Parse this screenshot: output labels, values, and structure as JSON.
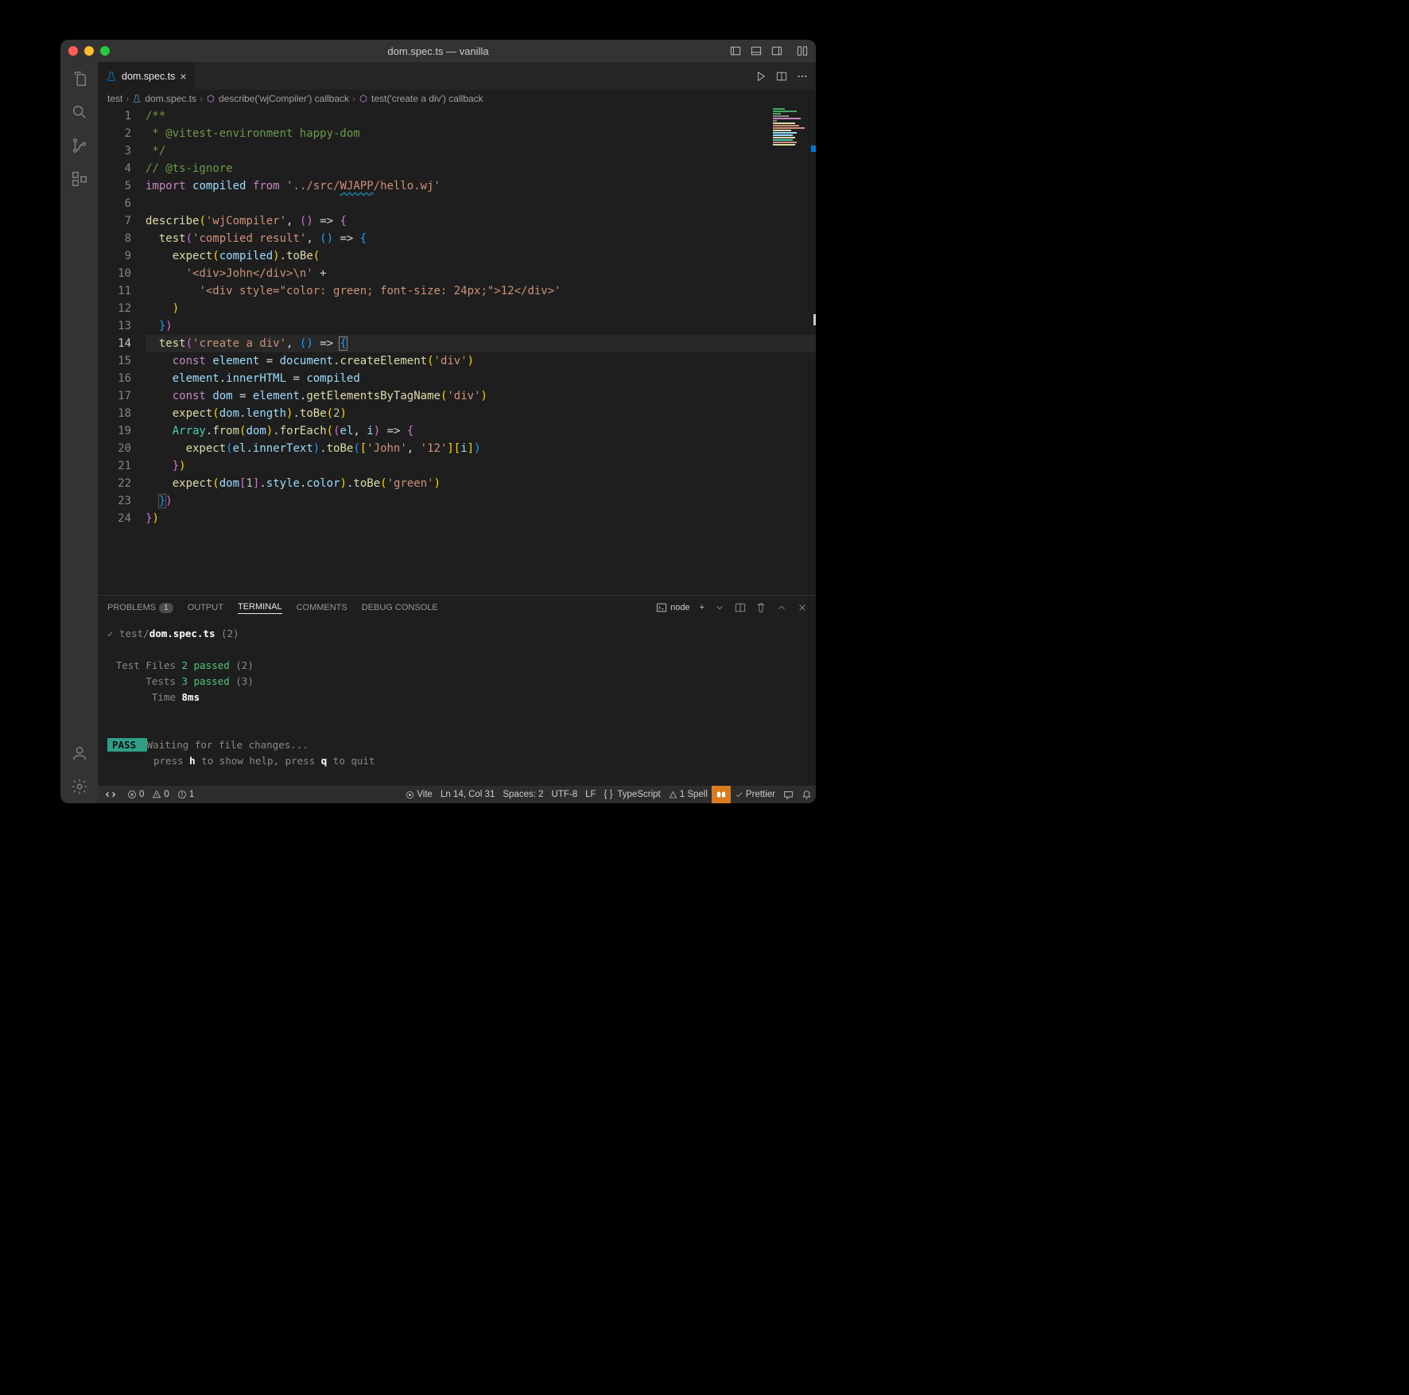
{
  "window": {
    "title": "dom.spec.ts — vanilla"
  },
  "tab": {
    "filename": "dom.spec.ts"
  },
  "breadcrumb": {
    "seg0": "test",
    "seg1": "dom.spec.ts",
    "seg2": "describe('wjCompiler') callback",
    "seg3": "test('create a div') callback"
  },
  "code": {
    "lines": [
      {
        "n": 1
      },
      {
        "n": 2
      },
      {
        "n": 3
      },
      {
        "n": 4
      },
      {
        "n": 5
      },
      {
        "n": 6
      },
      {
        "n": 7
      },
      {
        "n": 8
      },
      {
        "n": 9
      },
      {
        "n": 10
      },
      {
        "n": 11
      },
      {
        "n": 12
      },
      {
        "n": 13
      },
      {
        "n": 14,
        "cur": true
      },
      {
        "n": 15
      },
      {
        "n": 16
      },
      {
        "n": 17
      },
      {
        "n": 18
      },
      {
        "n": 19
      },
      {
        "n": 20
      },
      {
        "n": 21
      },
      {
        "n": 22
      },
      {
        "n": 23
      },
      {
        "n": 24
      }
    ],
    "l1": "/**",
    "l2": " * @vitest-environment happy-dom",
    "l3": " */",
    "l4": "// @ts-ignore",
    "l5_import": "import",
    "l5_compiled": "compiled",
    "l5_from": "from",
    "l5_path1": "'../src/",
    "l5_wjapp": "WJAPP",
    "l5_path2": "/hello.wj'",
    "l7_describe": "describe",
    "l7_str": "'wjCompiler'",
    "l8_test": "test",
    "l8_str": "'complied result'",
    "l9_expect": "expect",
    "l9_compiled": "compiled",
    "l9_toBe": "toBe",
    "l10_str": "'<div>John</div>\\n'",
    "l11_str": "'<div style=\"color: green; font-size: 24px;\">12</div>'",
    "l14_test": "test",
    "l14_str": "'create a div'",
    "l15_const": "const",
    "l15_element": "element",
    "l15_document": "document",
    "l15_createElement": "createElement",
    "l15_div": "'div'",
    "l16_element": "element",
    "l16_innerHTML": "innerHTML",
    "l16_compiled": "compiled",
    "l17_const": "const",
    "l17_dom": "dom",
    "l17_element": "element",
    "l17_fn": "getElementsByTagName",
    "l17_div": "'div'",
    "l18_expect": "expect",
    "l18_dom": "dom",
    "l18_length": "length",
    "l18_toBe": "toBe",
    "l18_two": "2",
    "l19_Array": "Array",
    "l19_from": "from",
    "l19_dom": "dom",
    "l19_forEach": "forEach",
    "l19_el": "el",
    "l19_i": "i",
    "l20_expect": "expect",
    "l20_el": "el",
    "l20_innerText": "innerText",
    "l20_toBe": "toBe",
    "l20_john": "'John'",
    "l20_12": "'12'",
    "l20_i": "i",
    "l22_expect": "expect",
    "l22_dom": "dom",
    "l22_1": "1",
    "l22_style": "style",
    "l22_color": "color",
    "l22_toBe": "toBe",
    "l22_green": "'green'"
  },
  "panel": {
    "problems": "PROBLEMS",
    "problems_count": "1",
    "output": "OUTPUT",
    "terminal": "TERMINAL",
    "comments": "COMMENTS",
    "debug": "DEBUG CONSOLE",
    "shell_label": "node"
  },
  "terminal": {
    "l1_pre": "✓ test/",
    "l1_file": "dom.spec.ts",
    "l1_post": " (2)",
    "sum_files_label": "Test Files",
    "sum_files_val": "2 passed",
    "sum_files_paren": " (2)",
    "sum_tests_label": "Tests",
    "sum_tests_val": "3 passed",
    "sum_tests_paren": " (3)",
    "sum_time_label": "Time",
    "sum_time_val": "8ms",
    "pass": " PASS ",
    "waiting": "Waiting for file changes...",
    "hint1": "press ",
    "hint_h": "h",
    "hint2": " to show help, press ",
    "hint_q": "q",
    "hint3": " to quit"
  },
  "status": {
    "errors": "0",
    "warnings": "0",
    "info": "1",
    "vite": "Vite",
    "cursor": "Ln 14, Col 31",
    "spaces": "Spaces: 2",
    "encoding": "UTF-8",
    "eol": "LF",
    "lang": "TypeScript",
    "spell": "1 Spell",
    "prettier": "Prettier"
  }
}
